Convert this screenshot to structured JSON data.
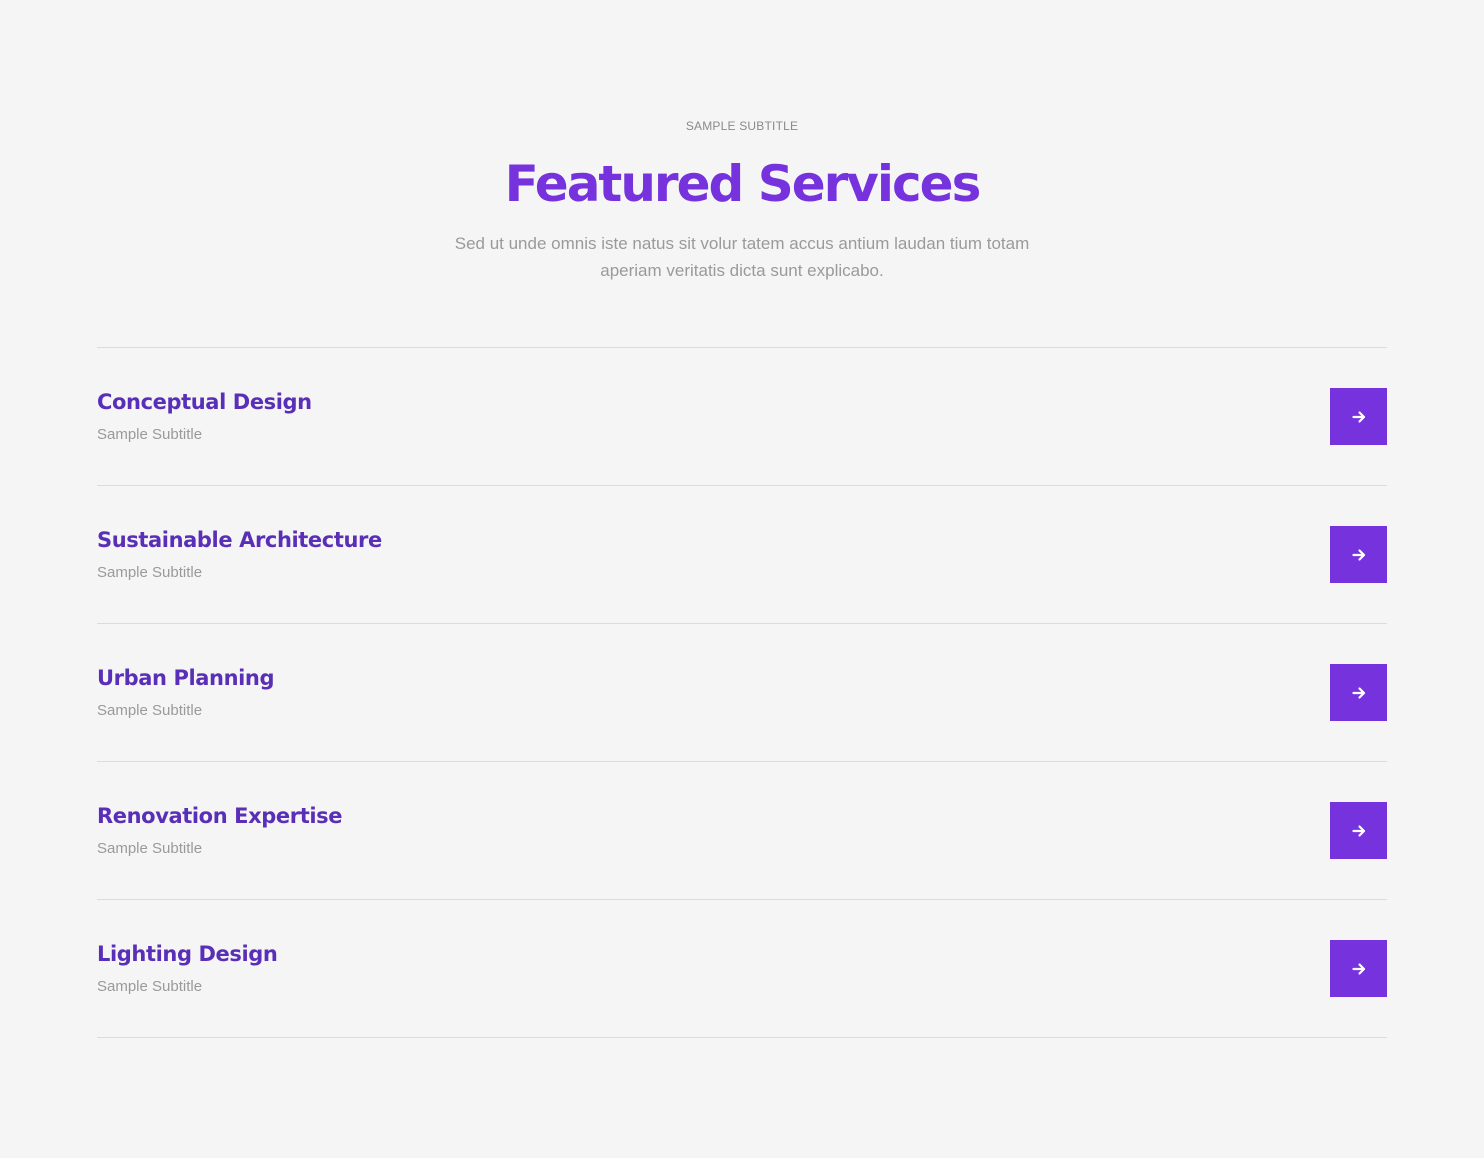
{
  "header": {
    "eyebrow": "SAMPLE SUBTITLE",
    "title": "Featured Services",
    "description": "Sed ut unde omnis iste natus sit volur tatem accus antium laudan tium totam aperiam veritatis dicta sunt explicabo."
  },
  "services": [
    {
      "title": "Conceptual Design",
      "subtitle": "Sample Subtitle",
      "icon": "arrow-right-icon"
    },
    {
      "title": "Sustainable Architecture",
      "subtitle": "Sample Subtitle",
      "icon": "arrow-right-icon"
    },
    {
      "title": "Urban Planning",
      "subtitle": "Sample Subtitle",
      "icon": "arrow-right-icon"
    },
    {
      "title": "Renovation Expertise",
      "subtitle": "Sample Subtitle",
      "icon": "arrow-right-icon"
    },
    {
      "title": "Lighting Design",
      "subtitle": "Sample Subtitle",
      "icon": "arrow-right-icon"
    }
  ],
  "colors": {
    "accent": "#7633dd",
    "item_title": "#5a2fb8",
    "muted_text": "#9a9a9a",
    "background": "#f5f5f5",
    "divider": "#dcdcdc"
  }
}
